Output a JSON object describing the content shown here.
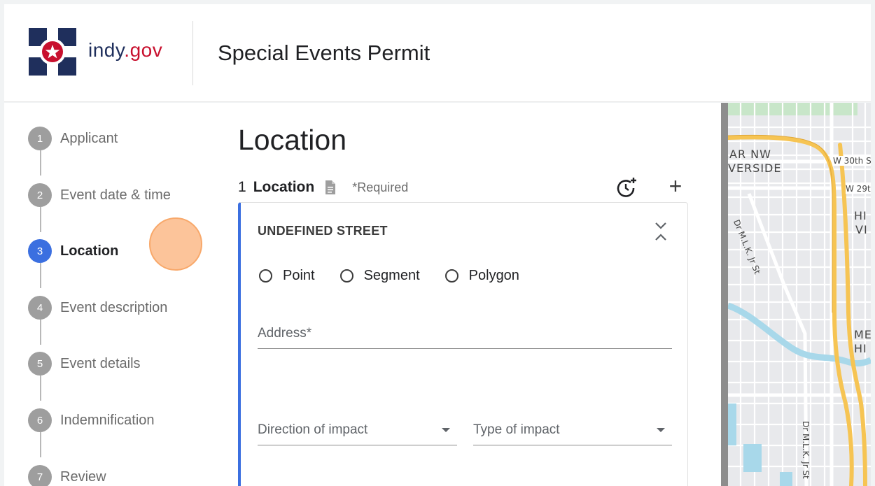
{
  "header": {
    "brand_main": "indy",
    "brand_suffix": ".gov",
    "title": "Special Events Permit"
  },
  "stepper": {
    "steps": [
      {
        "number": "1",
        "label": "Applicant"
      },
      {
        "number": "2",
        "label": "Event date & time"
      },
      {
        "number": "3",
        "label": "Location"
      },
      {
        "number": "4",
        "label": "Event description"
      },
      {
        "number": "5",
        "label": "Event details"
      },
      {
        "number": "6",
        "label": "Indemnification"
      },
      {
        "number": "7",
        "label": "Review"
      }
    ],
    "active_step": "3"
  },
  "content": {
    "page_title": "Location",
    "section_number": "1",
    "section_title": "Location",
    "required_note": "*Required",
    "card": {
      "title": "UNDEFINED STREET",
      "radio_options": [
        "Point",
        "Segment",
        "Polygon"
      ],
      "address_label": "Address*",
      "direction_label": "Direction of impact",
      "impact_label": "Type of impact"
    }
  },
  "map": {
    "labels": {
      "ar_nw": "AR NW",
      "verside": "VERSIDE",
      "w30th": "W 30th S",
      "w29": "W 29t",
      "hi": "HI",
      "vi": "VI",
      "me": "ME",
      "hi2": "HI",
      "mlk_top": "Dr M.L.K. Jr St",
      "mlk_bottom": "Dr M.L.K. Jr St"
    }
  },
  "colors": {
    "accent": "#3b6fe0",
    "brand_blue": "#1f2f5c",
    "brand_red": "#c8102e",
    "step_inactive": "#9e9e9e",
    "highway": "#f6c453",
    "water": "#a8d8ea",
    "park": "#c8e6c9"
  }
}
